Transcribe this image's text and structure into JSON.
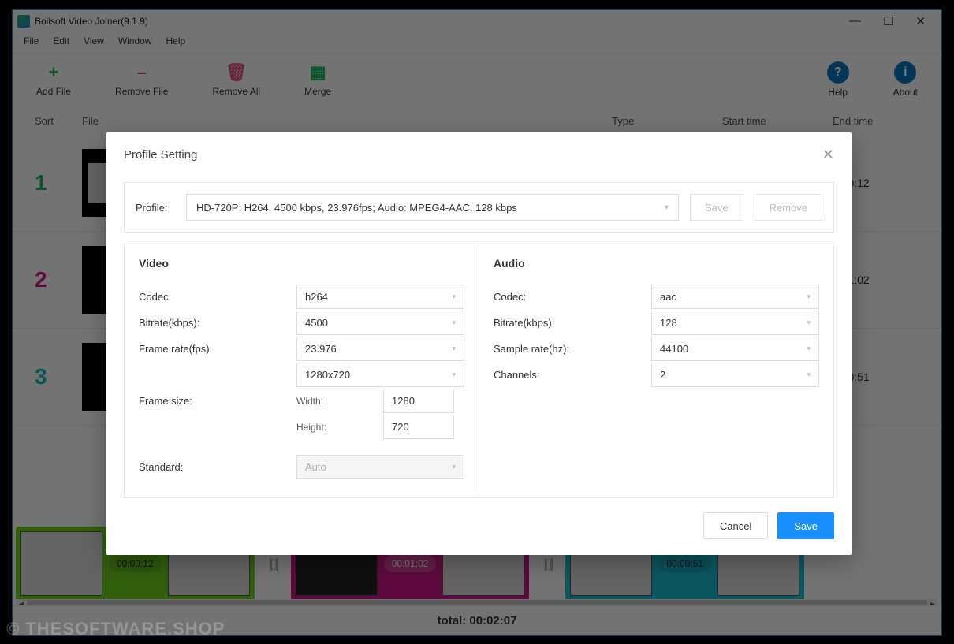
{
  "window": {
    "title": "Boilsoft Video Joiner(9.1.9)"
  },
  "menu": {
    "file": "File",
    "edit": "Edit",
    "view": "View",
    "window": "Window",
    "help": "Help"
  },
  "toolbar": {
    "add": "Add File",
    "remove": "Remove File",
    "removeAll": "Remove All",
    "merge": "Merge",
    "help": "Help",
    "about": "About"
  },
  "colors": {
    "add": "#1abc5c",
    "remove": "#e0517f",
    "removeAll": "#e0517f",
    "merge": "#1abc5c",
    "help": "#0b7bc1",
    "about": "#0b7bc1",
    "row1": "#1abc5c",
    "row2": "#d6168b",
    "row3": "#19b6c9",
    "clip1": "#6fd21f",
    "clip2": "#d6168b",
    "clip3": "#19c2d6"
  },
  "listHeaders": {
    "sort": "Sort",
    "file": "File",
    "type": "Type",
    "start": "Start time",
    "end": "End time"
  },
  "rows": [
    {
      "num": "1",
      "end": "0:00:12"
    },
    {
      "num": "2",
      "end": "0:01:02"
    },
    {
      "num": "3",
      "end": "0:00:51"
    }
  ],
  "timeline": [
    {
      "time": "00:00:12"
    },
    {
      "time": "00:01:02"
    },
    {
      "time": "00:00:51"
    }
  ],
  "footer": {
    "total": "total: 00:02:07"
  },
  "watermark": "© THESOFTWARE.SHOP",
  "modal": {
    "title": "Profile Setting",
    "profileLabel": "Profile:",
    "profileValue": "HD-720P: H264, 4500 kbps, 23.976fps; Audio: MPEG4-AAC, 128 kbps",
    "saveProfile": "Save",
    "removeProfile": "Remove",
    "video": {
      "header": "Video",
      "codecLabel": "Codec:",
      "codec": "h264",
      "bitrateLabel": "Bitrate(kbps):",
      "bitrate": "4500",
      "fpsLabel": "Frame rate(fps):",
      "fps": "23.976",
      "sizePreset": "1280x720",
      "sizeLabel": "Frame size:",
      "widthLabel": "Width:",
      "width": "1280",
      "heightLabel": "Height:",
      "height": "720",
      "standardLabel": "Standard:",
      "standard": "Auto"
    },
    "audio": {
      "header": "Audio",
      "codecLabel": "Codec:",
      "codec": "aac",
      "bitrateLabel": "Bitrate(kbps):",
      "bitrate": "128",
      "sampleLabel": "Sample rate(hz):",
      "sample": "44100",
      "channelsLabel": "Channels:",
      "channels": "2"
    },
    "cancel": "Cancel",
    "save": "Save"
  }
}
